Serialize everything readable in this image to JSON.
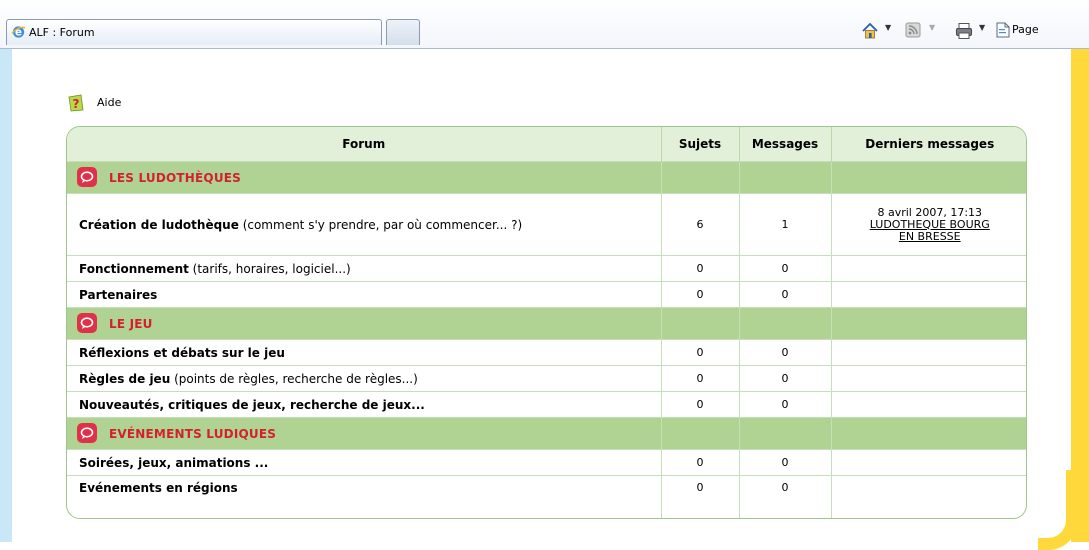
{
  "browser": {
    "tab_title": "ALF : Forum",
    "page_label": "Page"
  },
  "help": {
    "label": "Aide"
  },
  "forum_table": {
    "headers": {
      "forum": "Forum",
      "topics": "Sujets",
      "messages": "Messages",
      "last_posts": "Derniers messages"
    },
    "categories": [
      {
        "title": "LES LUDOTHÈQUES",
        "forums": [
          {
            "name": "Création de ludothèque",
            "desc": " (comment s'y prendre, par où commencer... ?)",
            "topics": "6",
            "messages": "1",
            "last_date": "8 avril 2007, 17:13",
            "last_author_line1": "LUDOTHEQUE BOURG",
            "last_author_line2": "EN BRESSE"
          },
          {
            "name": "Fonctionnement",
            "desc": " (tarifs, horaires, logiciel...)",
            "topics": "0",
            "messages": "0"
          },
          {
            "name": "Partenaires",
            "desc": "",
            "topics": "0",
            "messages": "0"
          }
        ]
      },
      {
        "title": "LE JEU",
        "forums": [
          {
            "name": "Réflexions et débats sur le jeu",
            "desc": "",
            "topics": "0",
            "messages": "0"
          },
          {
            "name": "Règles de jeu",
            "desc": " (points de règles, recherche de règles...)",
            "topics": "0",
            "messages": "0"
          },
          {
            "name": "Nouveautés, critiques de jeux, recherche de jeux...",
            "desc": "",
            "topics": "0",
            "messages": "0"
          }
        ]
      },
      {
        "title": "EVÉNEMENTS LUDIQUES",
        "forums": [
          {
            "name": "Soirées, jeux, animations ...",
            "desc": "",
            "topics": "0",
            "messages": "0"
          },
          {
            "name": "Evénements en régions",
            "desc": "",
            "topics": "0",
            "messages": "0"
          }
        ]
      }
    ]
  },
  "colors": {
    "header_bg": "#e3f0d9",
    "category_bg": "#b0d394",
    "category_text": "#d4202e",
    "frame_yellow": "#ffd83b",
    "frame_blue": "#c9e7f6"
  },
  "icons": [
    "ie-icon",
    "home-icon",
    "feeds-icon",
    "print-icon",
    "page-icon",
    "help-icon",
    "category-icon"
  ]
}
